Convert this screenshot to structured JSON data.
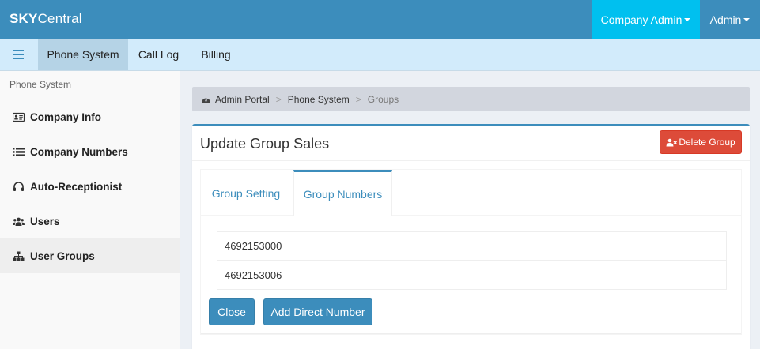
{
  "colors": {
    "navbar": "#3c8dbc",
    "company_menu_bg": "#00c0ef",
    "subnav": "#d2ebfb",
    "subnav_active": "#b5d3e6",
    "danger": "#dd4b39",
    "primary": "#3c8dbc"
  },
  "header": {
    "brand_bold": "SKY",
    "brand_rest": "Central",
    "company_menu_label": "Company Admin",
    "user_menu_label": "Admin"
  },
  "subnav": {
    "menu_icon": "hamburger-icon",
    "tabs": [
      {
        "label": "Phone System",
        "active": true
      },
      {
        "label": "Call Log",
        "active": false
      },
      {
        "label": "Billing",
        "active": false
      }
    ]
  },
  "sidebar": {
    "header": "Phone System",
    "items": [
      {
        "label": "Company Info",
        "icon": "id-card-icon",
        "active": false
      },
      {
        "label": "Company Numbers",
        "icon": "list-icon",
        "active": false
      },
      {
        "label": "Auto-Receptionist",
        "icon": "headphones-icon",
        "active": false
      },
      {
        "label": "Users",
        "icon": "users-icon",
        "active": false
      },
      {
        "label": "User Groups",
        "icon": "sitemap-icon",
        "active": true
      }
    ]
  },
  "breadcrumb": {
    "icon": "dashboard-icon",
    "items": [
      "Admin Portal",
      "Phone System",
      "Groups"
    ],
    "separator": ">"
  },
  "box": {
    "title": "Update Group Sales",
    "delete_button": "Delete Group",
    "delete_icon": "user-times-icon"
  },
  "tabs": [
    {
      "label": "Group Setting",
      "active": false
    },
    {
      "label": "Group Numbers",
      "active": true
    }
  ],
  "numbers": [
    "4692153000",
    "4692153006"
  ],
  "actions": {
    "close": "Close",
    "add_direct_number": "Add Direct Number"
  }
}
